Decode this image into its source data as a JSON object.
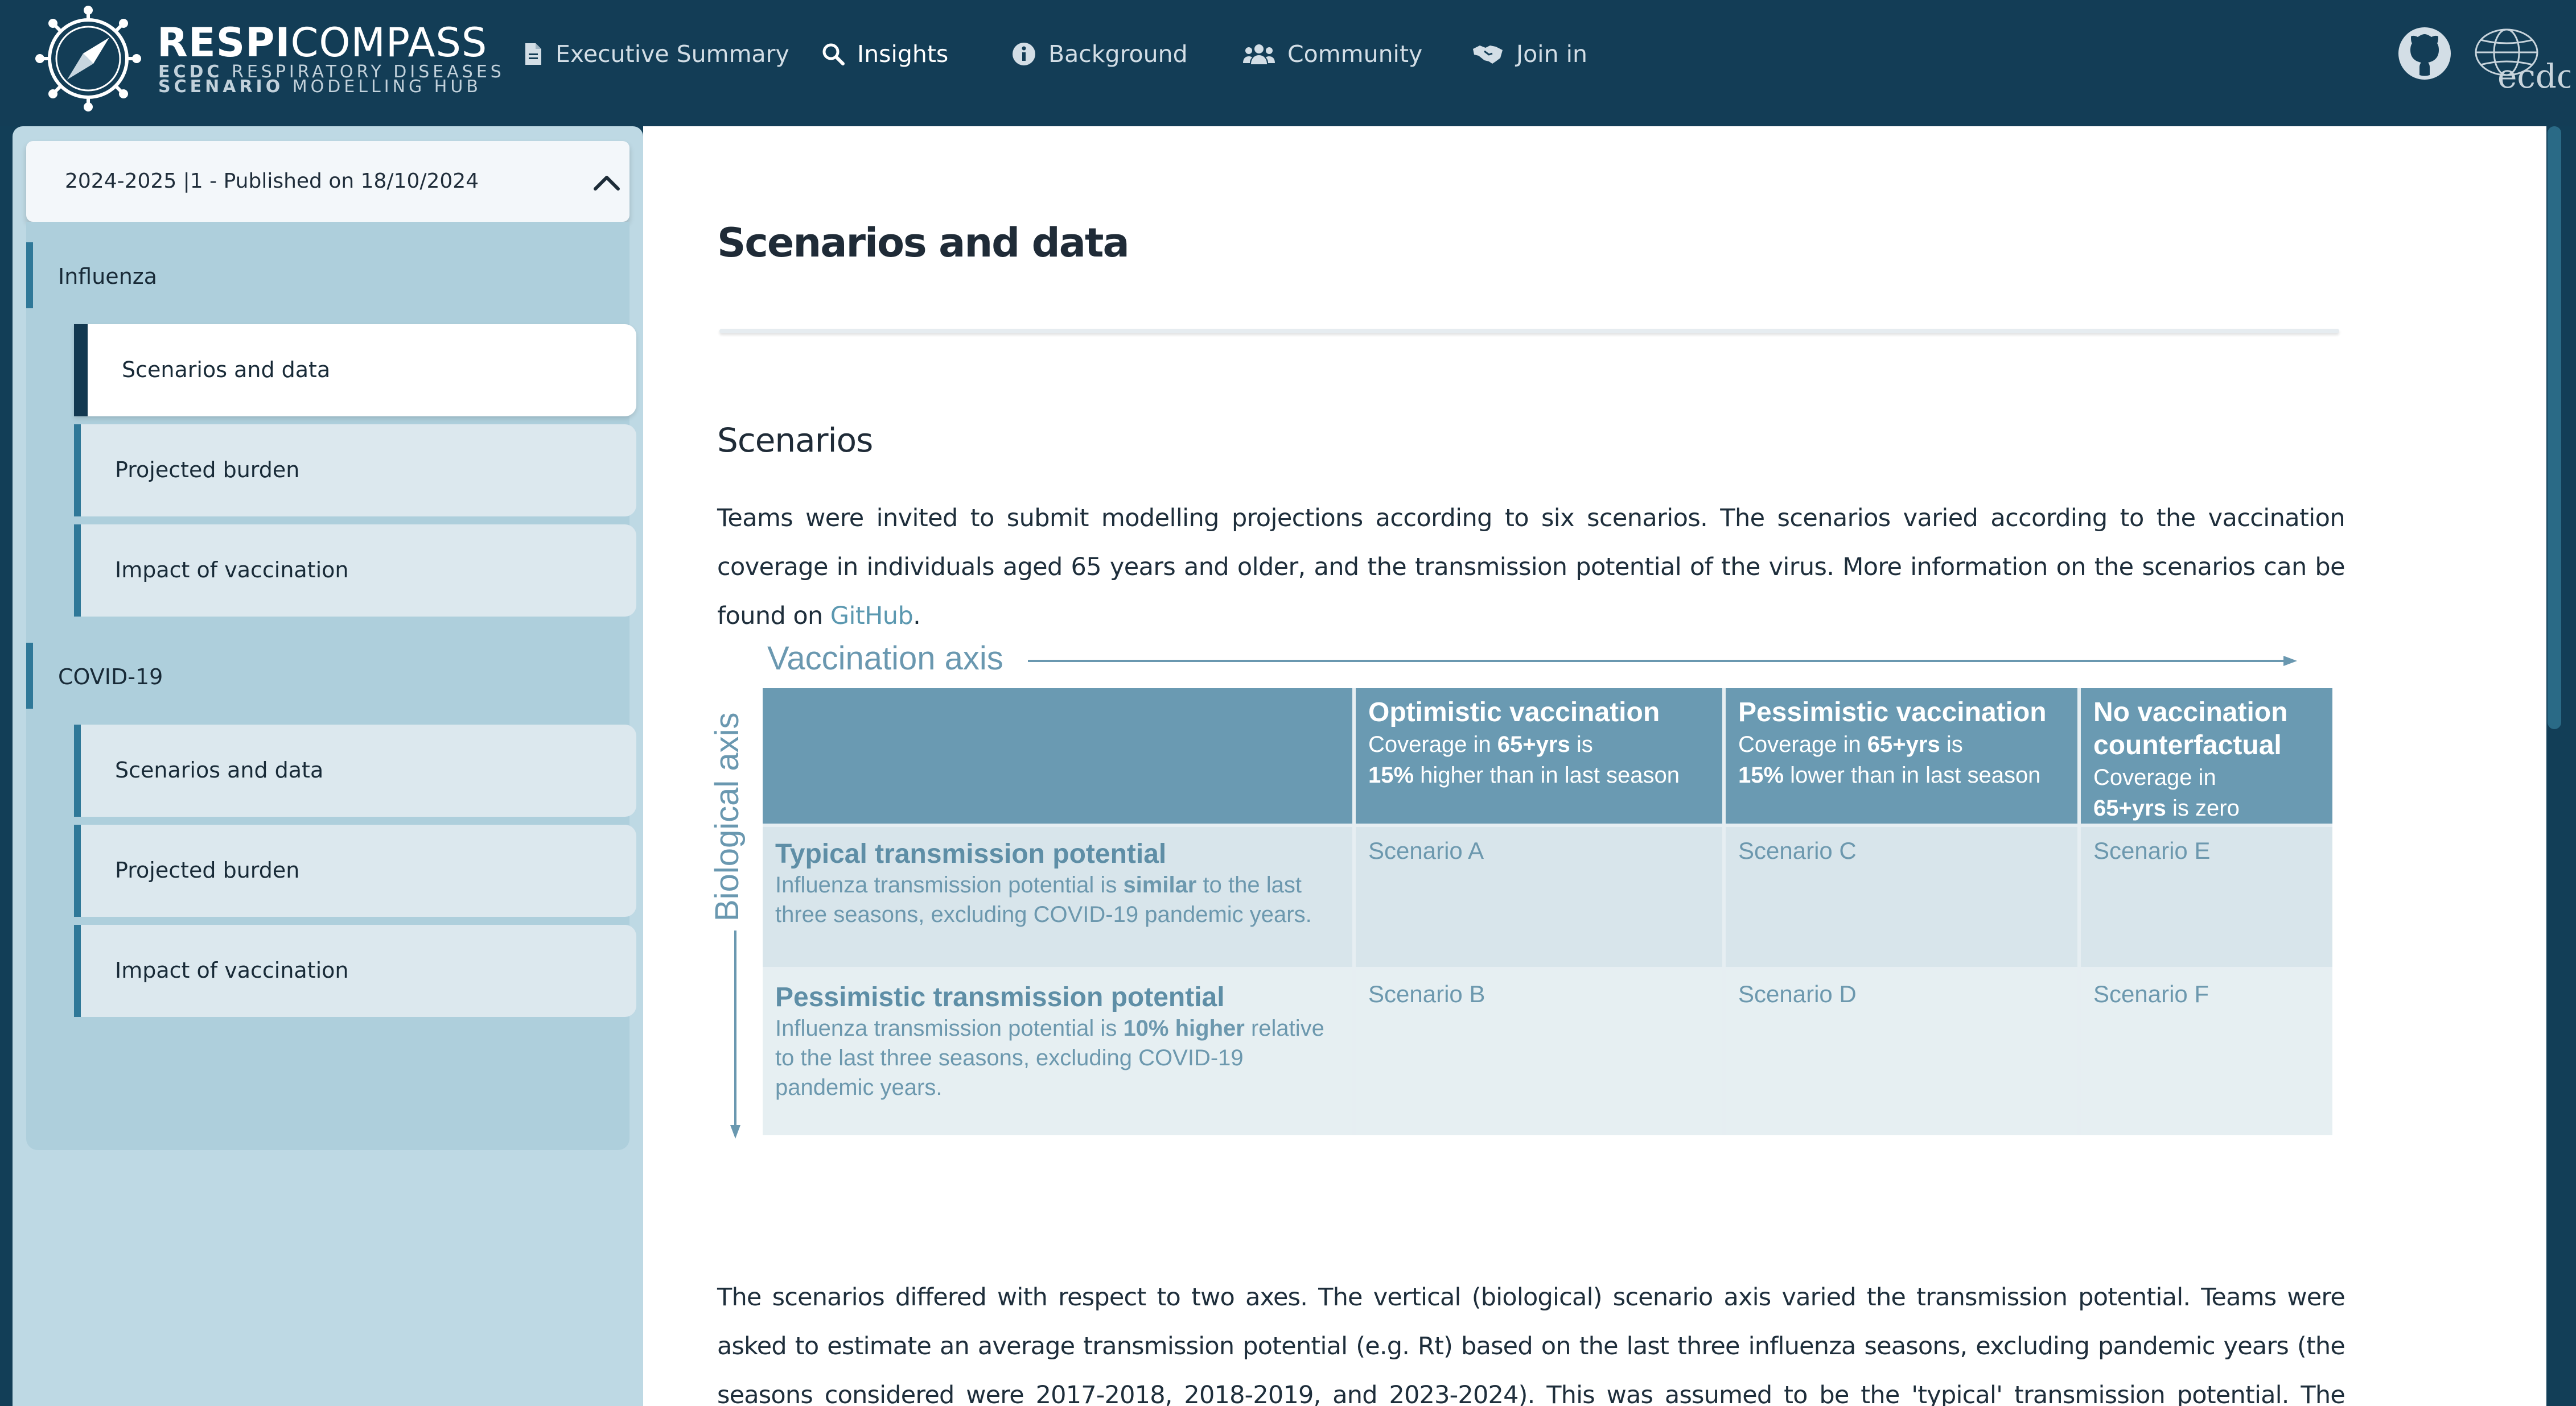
{
  "brand": {
    "title_bold": "RESPI",
    "title_light": "COMPASS",
    "sub1_bold": "ECDC",
    "sub1_rest": " RESPIRATORY DISEASES",
    "sub2_bold": "SCENARIO",
    "sub2_rest": " MODELLING HUB",
    "ecdc_logo_text": "ecdc"
  },
  "nav": {
    "items": [
      {
        "label": "Executive Summary",
        "icon": "document-icon",
        "active": false
      },
      {
        "label": "Insights",
        "icon": "magnifier-icon",
        "active": true
      },
      {
        "label": "Background",
        "icon": "info-icon",
        "active": false
      },
      {
        "label": "Community",
        "icon": "people-icon",
        "active": false
      },
      {
        "label": "Join in",
        "icon": "handshake-icon",
        "active": false
      }
    ],
    "github_icon": "github-icon"
  },
  "sidebar": {
    "version": "2024-2025 |1 -  Published on 18/10/2024",
    "groups": [
      {
        "label": "Influenza",
        "items": [
          {
            "label": "Scenarios and data",
            "active": true
          },
          {
            "label": "Projected burden",
            "active": false
          },
          {
            "label": "Impact of vaccination",
            "active": false
          }
        ]
      },
      {
        "label": "COVID-19",
        "items": [
          {
            "label": "Scenarios and data",
            "active": false
          },
          {
            "label": "Projected burden",
            "active": false
          },
          {
            "label": "Impact of vaccination",
            "active": false
          }
        ]
      }
    ]
  },
  "main": {
    "title": "Scenarios and data",
    "section_title": "Scenarios",
    "para1_text": "Teams were invited to submit modelling projections according to six scenarios. The scenarios varied according to the vaccination coverage in individuals aged 65 years and older, and the transmission potential of the virus.  More information on the scenarios can be found on ",
    "para1_link": "GitHub",
    "para1_end": ".",
    "para2": "The scenarios differed with respect to two axes. The vertical (biological) scenario axis varied the transmission potential. Teams were asked to estimate an average transmission potential (e.g.  Rt) based on the last three influenza seasons, excluding pandemic years (the seasons considered were 2017-2018, 2018-2019, and 2023-2024). This was assumed to be the 'typical' transmission potential. The pessimistic"
  },
  "figure": {
    "vaccination_axis": "Vaccination axis",
    "biological_axis": "Biological axis",
    "columns": [
      {
        "title": "Optimistic vaccination",
        "d1": "Coverage in ",
        "d1b": "65+yrs",
        "d1c": " is",
        "d2b": "15%",
        "d2": " higher than in last season"
      },
      {
        "title": "Pessimistic vaccination",
        "d1": "Coverage in ",
        "d1b": "65+yrs",
        "d1c": " is",
        "d2b": "15%",
        "d2": " lower than in last season"
      },
      {
        "title": "No vaccination counterfactual",
        "d1": "Coverage in",
        "d2b": "65+yrs",
        "d2": " is zero"
      }
    ],
    "rows": [
      {
        "title": "Typical transmission potential",
        "d1": "Influenza transmission potential is ",
        "d1b": "similar",
        "d1c": " to the last three seasons, excluding COVID-19 pandemic years.",
        "scenarios": [
          "Scenario A",
          "Scenario C",
          "Scenario E"
        ]
      },
      {
        "title": "Pessimistic transmission potential",
        "d1": "Influenza transmission potential is ",
        "d1b": "10% higher",
        "d1c": " relative to the last three seasons, excluding COVID-19 pandemic years.",
        "scenarios": [
          "Scenario B",
          "Scenario D",
          "Scenario F"
        ]
      }
    ]
  },
  "colors": {
    "navbar": "#133d56",
    "sidebar": "#bed9e4",
    "accent": "#2f7898",
    "table_header": "#6a9ab2",
    "link": "#5b98b0"
  }
}
